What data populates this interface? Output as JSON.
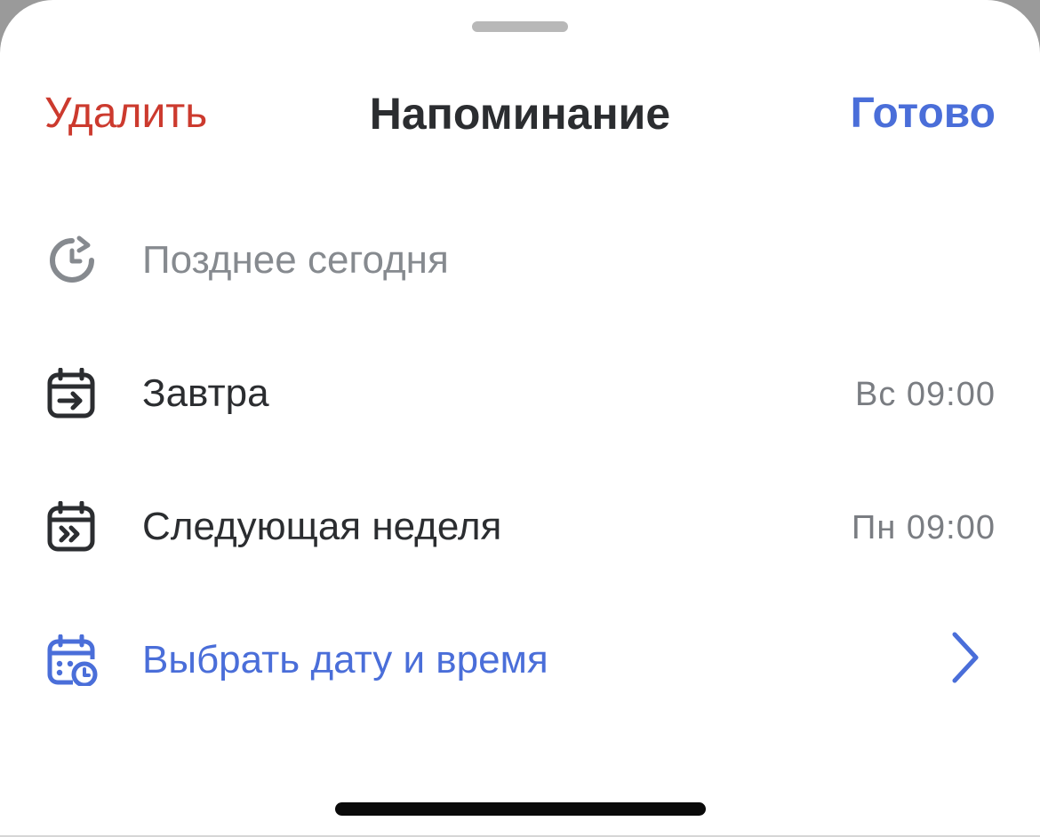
{
  "header": {
    "delete_label": "Удалить",
    "title": "Напоминание",
    "done_label": "Готово"
  },
  "options": [
    {
      "label": "Позднее сегодня",
      "time": "",
      "icon": "clock-refresh-icon",
      "state": "disabled"
    },
    {
      "label": "Завтра",
      "time": "Вс 09:00",
      "icon": "calendar-arrow-right-icon",
      "state": "normal"
    },
    {
      "label": "Следующая неделя",
      "time": "Пн 09:00",
      "icon": "calendar-double-chevron-icon",
      "state": "normal"
    },
    {
      "label": "Выбрать дату и время",
      "time": "",
      "icon": "calendar-clock-icon",
      "state": "accent"
    }
  ],
  "colors": {
    "delete": "#cc3a2e",
    "accent": "#4a6ed9",
    "text": "#2b2d30",
    "secondary": "#7a7d82",
    "disabled": "#868a8f"
  }
}
